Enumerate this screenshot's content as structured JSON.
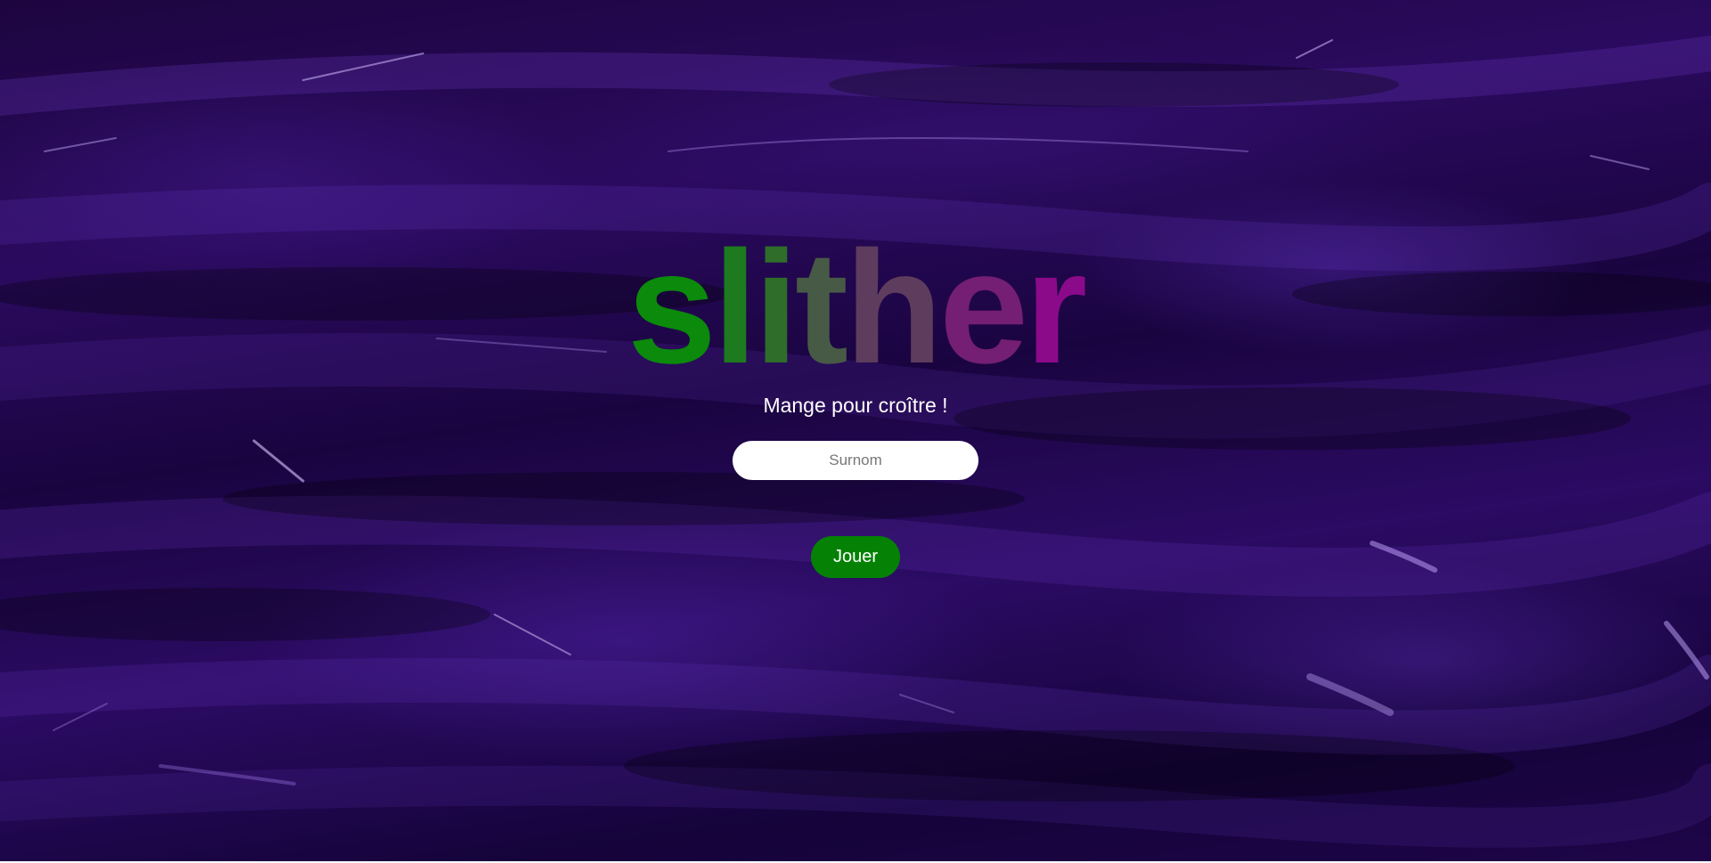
{
  "title": {
    "letters": [
      "s",
      "l",
      "i",
      "t",
      "h",
      "e",
      "r"
    ],
    "colors": [
      "#0b8a0b",
      "#1e7a1e",
      "#2f6d2a",
      "#475a45",
      "#5e3c5e",
      "#741e74",
      "#8a0a8a"
    ]
  },
  "subtitle": "Mange pour croître !",
  "nickname": {
    "placeholder": "Surnom",
    "value": ""
  },
  "play_button": {
    "label": "Jouer",
    "color": "#058205"
  },
  "background": {
    "description_color": "#2a0a5e"
  }
}
